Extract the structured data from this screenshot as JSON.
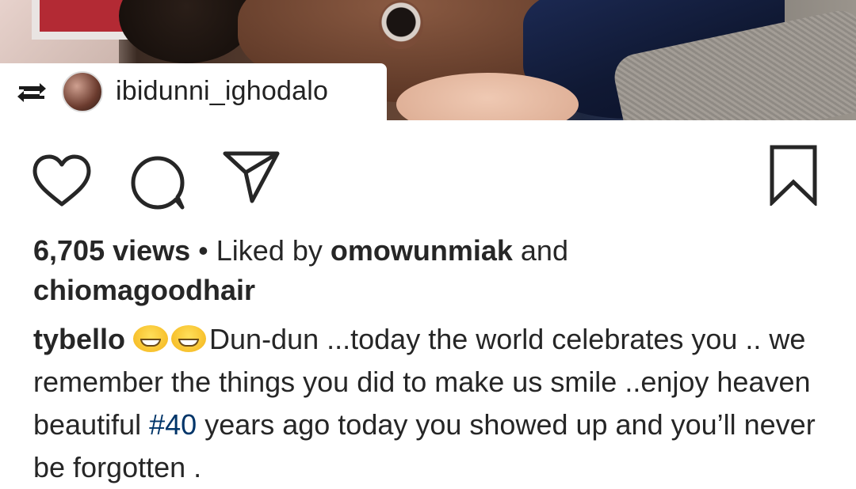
{
  "repost": {
    "username": "ibidunni_ighodalo"
  },
  "icons": {
    "repost": "repost-icon",
    "like": "heart-icon",
    "comment": "comment-icon",
    "share": "paper-plane-icon",
    "save": "bookmark-icon"
  },
  "stats": {
    "views": "6,705 views",
    "separator": " • Liked by ",
    "liker1": "omowunmiak",
    "and": " and",
    "liker2": "chiomagoodhair"
  },
  "caption": {
    "author": "tybello",
    "text1": "Dun-dun ...today the world celebrates you .. we remember the things you did to make us smile ..enjoy heaven beautiful ",
    "hashtag": "#40",
    "text2": " years ago today you showed up and you’ll never be forgotten ."
  },
  "colors": {
    "hashtag": "#003569",
    "text": "#262626"
  }
}
